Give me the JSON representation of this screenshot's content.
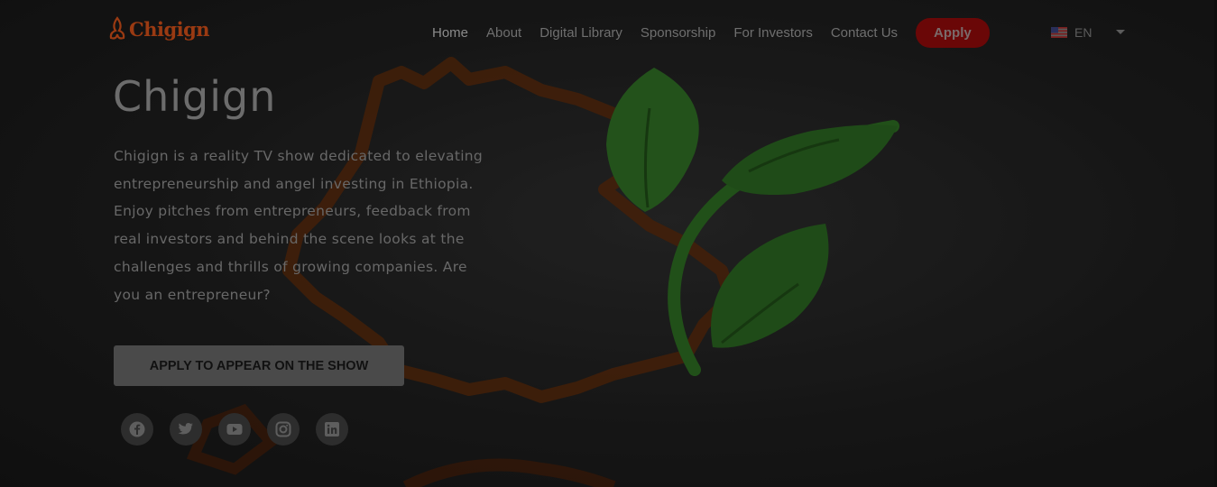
{
  "header": {
    "logo_text": "Chigign",
    "nav": [
      {
        "label": "Home",
        "active": true
      },
      {
        "label": "About"
      },
      {
        "label": "Digital Library"
      },
      {
        "label": "Sponsorship"
      },
      {
        "label": "For Investors"
      },
      {
        "label": "Contact Us"
      }
    ],
    "apply_label": "Apply",
    "language": "EN"
  },
  "hero": {
    "title": "Chigign",
    "description": "Chigign is a reality TV show dedicated to elevating entrepreneurship and angel investing in Ethiopia. Enjoy pitches from entrepreneurs, feedback from real investors and behind the scene looks at the challenges and thrills of growing companies. Are you an entrepreneur?",
    "cta_label": "APPLY TO APPEAR ON THE SHOW"
  },
  "socials": [
    "facebook-icon",
    "twitter-icon",
    "youtube-icon",
    "instagram-icon",
    "linkedin-icon"
  ],
  "colors": {
    "brand": "#9a3a12",
    "apply_bg": "#6a0707",
    "leaf": "#2a6b1f",
    "map_outline": "#5a2a0c"
  }
}
